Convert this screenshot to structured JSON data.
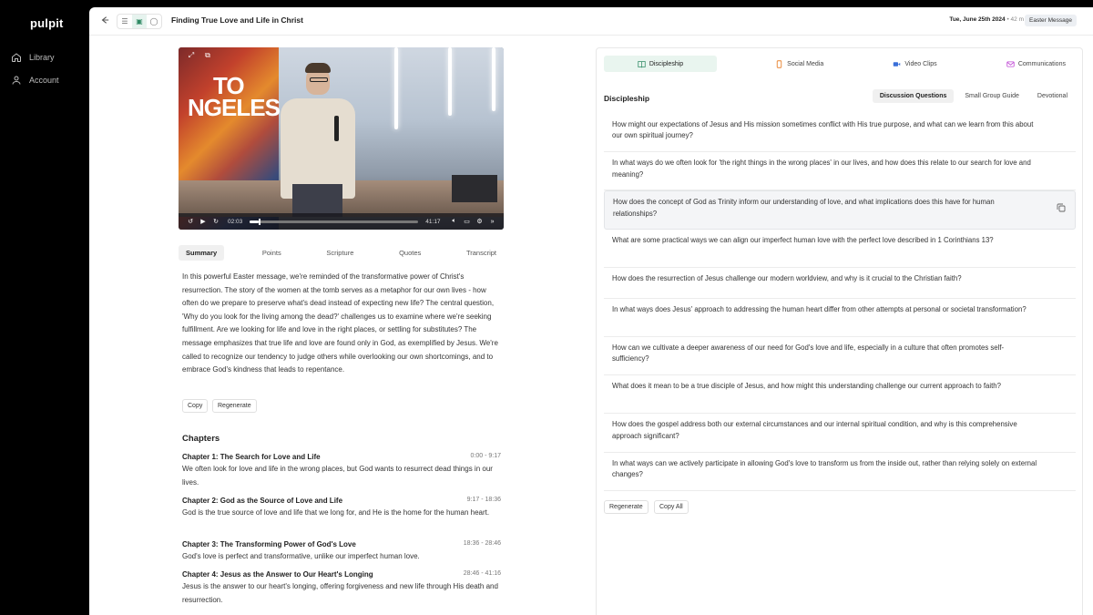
{
  "sidebar": {
    "logo": "pulpit",
    "items": [
      {
        "label": "Library",
        "icon": "home-icon"
      },
      {
        "label": "Account",
        "icon": "user-icon"
      }
    ]
  },
  "header": {
    "title": "Finding True Love and Life in Christ",
    "date": "Tue, June 25th 2024",
    "duration": "42 m",
    "badge": "Easter Message"
  },
  "video": {
    "overlay_text_line1": "TO",
    "overlay_text_line2": "NGELES",
    "current_time": "02:03",
    "total_time": "41:17",
    "progress": 0.05
  },
  "left_tabs": [
    "Summary",
    "Points",
    "Scripture",
    "Quotes",
    "Transcript"
  ],
  "summary": {
    "text": "In this powerful Easter message, we're reminded of the transformative power of Christ's resurrection. The story of the women at the tomb serves as a metaphor for our own lives - how often do we prepare to preserve what's dead instead of expecting new life? The central question, 'Why do you look for the living among the dead?' challenges us to examine where we're seeking fulfillment. Are we looking for life and love in the right places, or settling for substitutes? The message emphasizes that true life and love are found only in God, as exemplified by Jesus. We're called to recognize our tendency to judge others while overlooking our own shortcomings, and to embrace God's kindness that leads to repentance.",
    "copy_label": "Copy",
    "regenerate_label": "Regenerate"
  },
  "chapters": {
    "title": "Chapters",
    "items": [
      {
        "title": "Chapter 1: The Search for Love and Life",
        "time": "0:00 - 9:17",
        "desc": "We often look for love and life in the wrong places, but God wants to resurrect dead things in our lives."
      },
      {
        "title": "Chapter 2: God as the Source of Love and Life",
        "time": "9:17 - 18:36",
        "desc": "God is the true source of love and life that we long for, and He is the home for the human heart."
      },
      {
        "title": "Chapter 3: The Transforming Power of God's Love",
        "time": "18:36 - 28:46",
        "desc": "God's love is perfect and transformative, unlike our imperfect human love."
      },
      {
        "title": "Chapter 4: Jesus as the Answer to Our Heart's Longing",
        "time": "28:46 - 41:16",
        "desc": "Jesus is the answer to our heart's longing, offering forgiveness and new life through His death and resurrection."
      }
    ]
  },
  "panel": {
    "tabs": [
      {
        "label": "Discipleship",
        "icon": "book-icon",
        "color": "#2f8a64"
      },
      {
        "label": "Social Media",
        "icon": "phone-icon",
        "color": "#e8822e"
      },
      {
        "label": "Video Clips",
        "icon": "video-icon",
        "color": "#3a6fd8"
      },
      {
        "label": "Communications",
        "icon": "mail-icon",
        "color": "#c04bd6"
      }
    ],
    "heading": "Discipleship",
    "subtabs": [
      "Discussion Questions",
      "Small Group Guide",
      "Devotional"
    ],
    "questions": [
      "How might our expectations of Jesus and His mission sometimes conflict with His true purpose, and what can we learn from this about our own spiritual journey?",
      "In what ways do we often look for 'the right things in the wrong places' in our lives, and how does this relate to our search for love and meaning?",
      "How does the concept of God as Trinity inform our understanding of love, and what implications does this have for human relationships?",
      "What are some practical ways we can align our imperfect human love with the perfect love described in 1 Corinthians 13?",
      "How does the resurrection of Jesus challenge our modern worldview, and why is it crucial to the Christian faith?",
      "In what ways does Jesus' approach to addressing the human heart differ from other attempts at personal or societal transformation?",
      "How can we cultivate a deeper awareness of our need for God's love and life, especially in a culture that often promotes self-sufficiency?",
      "What does it mean to be a true disciple of Jesus, and how might this understanding challenge our current approach to faith?",
      "How does the gospel address both our external circumstances and our internal spiritual condition, and why is this comprehensive approach significant?",
      "In what ways can we actively participate in allowing God's love to transform us from the inside out, rather than relying solely on external changes?"
    ],
    "regenerate_label": "Regenerate",
    "copy_all_label": "Copy All"
  }
}
